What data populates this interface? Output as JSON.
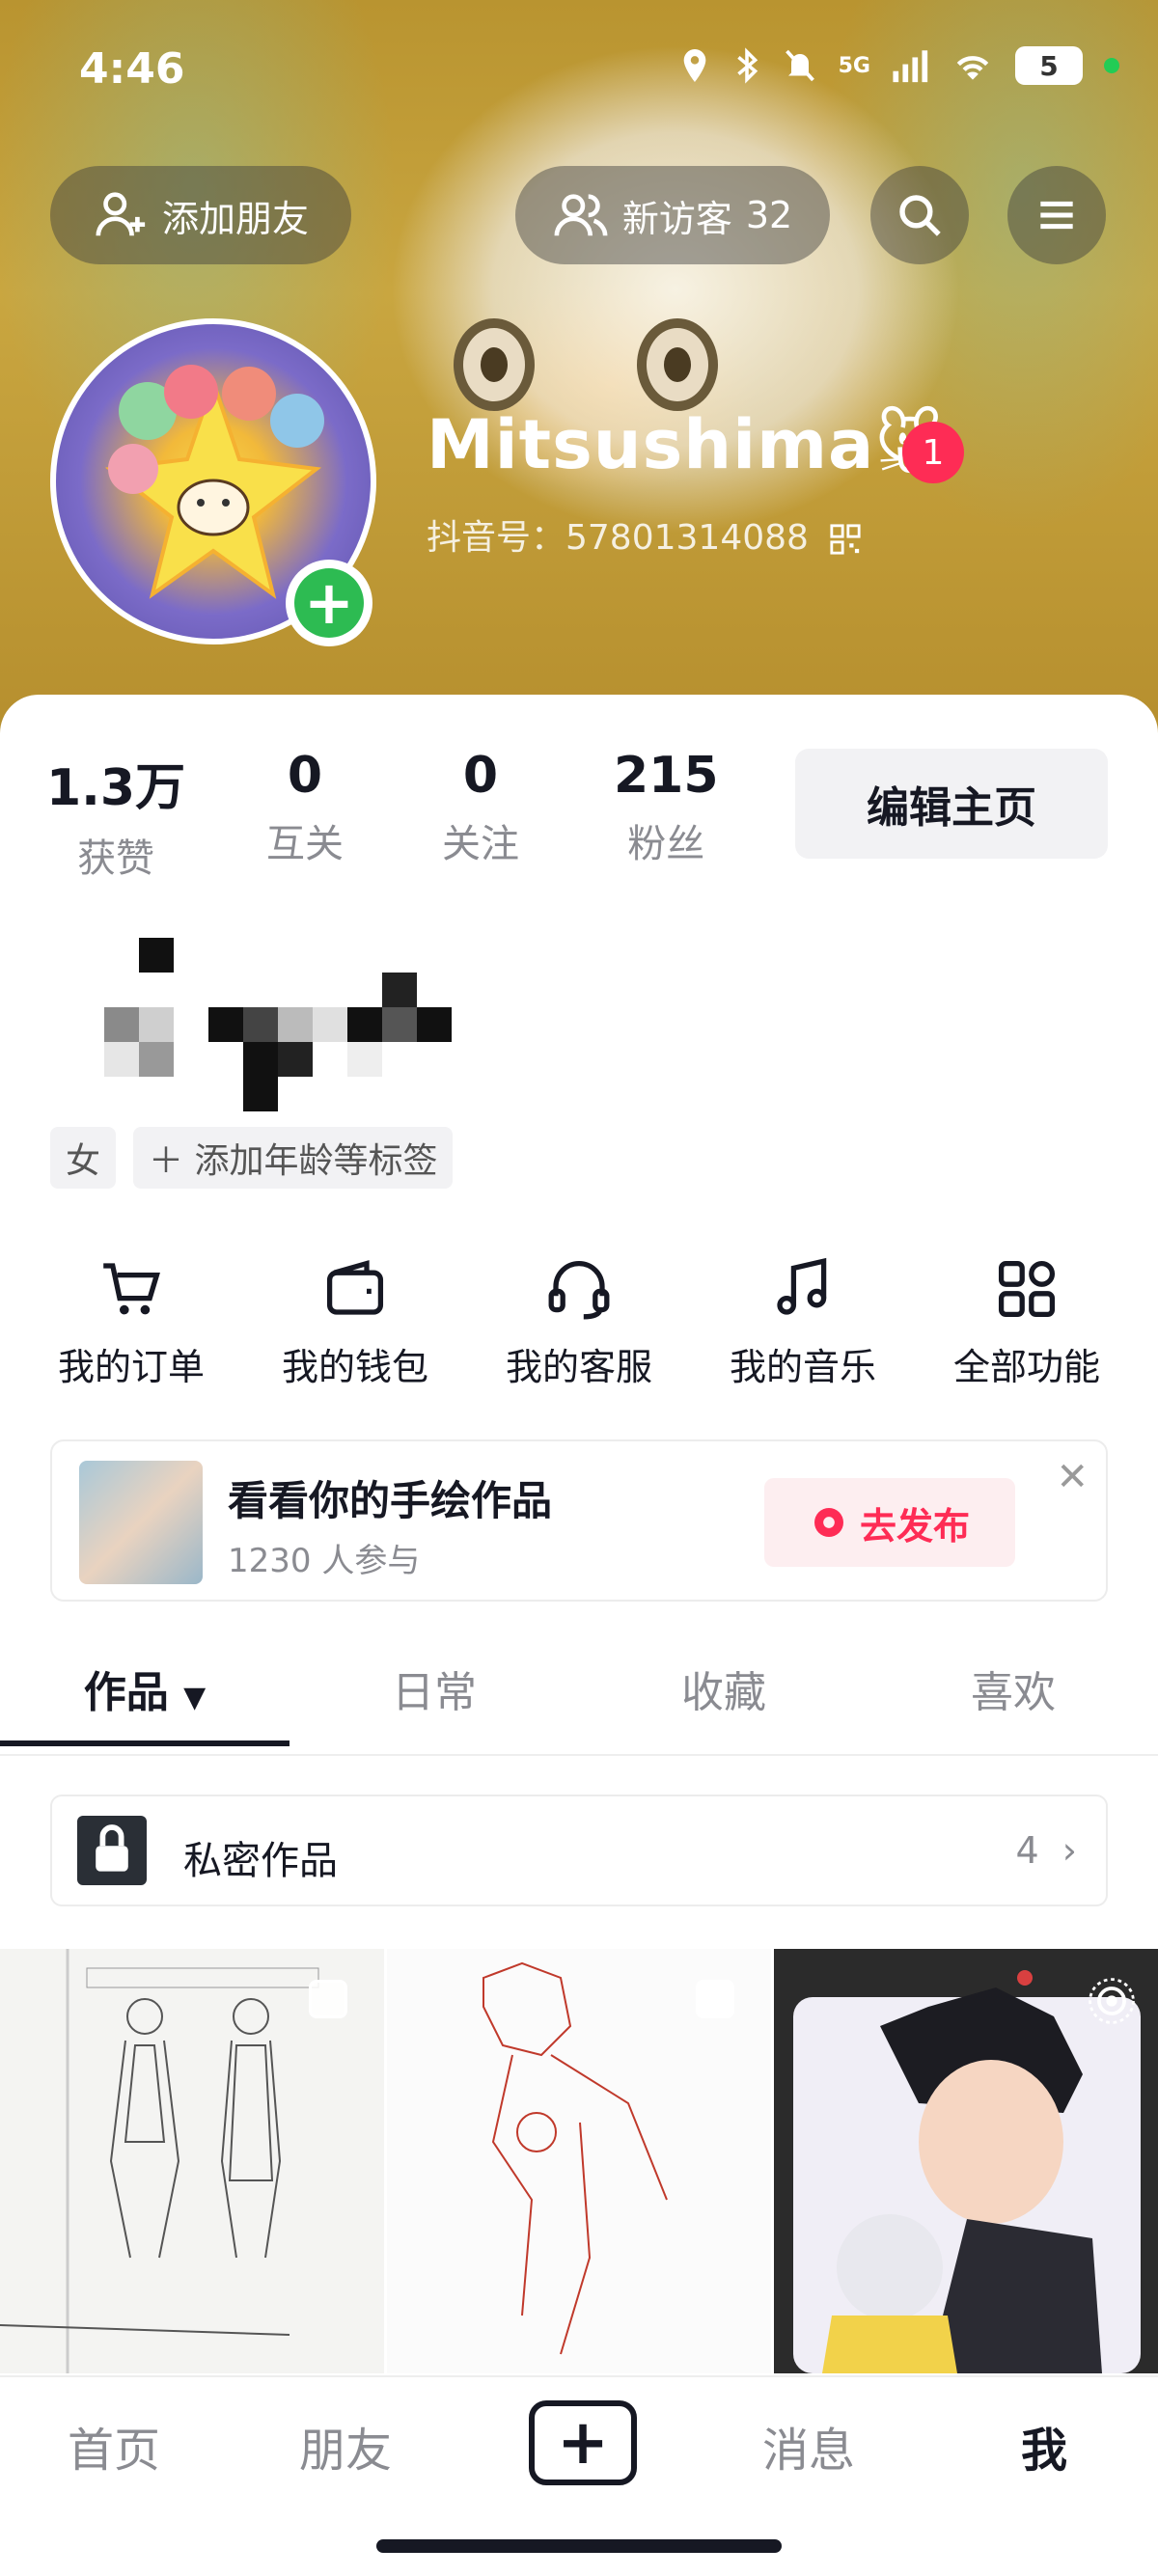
{
  "status_bar": {
    "time": "4:46",
    "network": "5G",
    "battery": "5"
  },
  "top_actions": {
    "add_friend": "添加朋友",
    "new_visitors_label": "新访客",
    "new_visitors_count": "32"
  },
  "profile": {
    "username": "Mitsushima🐭",
    "notification_count": "1",
    "douyin_id": "抖音号：57801314088"
  },
  "stats": [
    {
      "value": "1.3万",
      "label": "获赞"
    },
    {
      "value": "0",
      "label": "互关"
    },
    {
      "value": "0",
      "label": "关注"
    },
    {
      "value": "215",
      "label": "粉丝"
    }
  ],
  "edit_button": "编辑主页",
  "tags": {
    "gender": "女",
    "add_tags": "＋ 添加年龄等标签"
  },
  "functions": [
    {
      "label": "我的订单",
      "icon": "cart-icon"
    },
    {
      "label": "我的钱包",
      "icon": "wallet-icon"
    },
    {
      "label": "我的客服",
      "icon": "headset-icon"
    },
    {
      "label": "我的音乐",
      "icon": "music-note-icon"
    },
    {
      "label": "全部功能",
      "icon": "grid-icon"
    }
  ],
  "promo": {
    "title": "看看你的手绘作品",
    "participants": "1230 人参与",
    "action": "去发布"
  },
  "tabs": [
    {
      "label": "作品",
      "active": true
    },
    {
      "label": "日常",
      "active": false
    },
    {
      "label": "收藏",
      "active": false
    },
    {
      "label": "喜欢",
      "active": false
    }
  ],
  "private_works": {
    "label": "私密作品",
    "count": "4"
  },
  "bottom_nav": {
    "home": "首页",
    "friends": "朋友",
    "messages": "消息",
    "me": "我"
  },
  "colors": {
    "accent_red": "#fe2c55",
    "add_green": "#2dbb52",
    "text_primary": "#161823",
    "text_secondary": "#8a8b91"
  }
}
